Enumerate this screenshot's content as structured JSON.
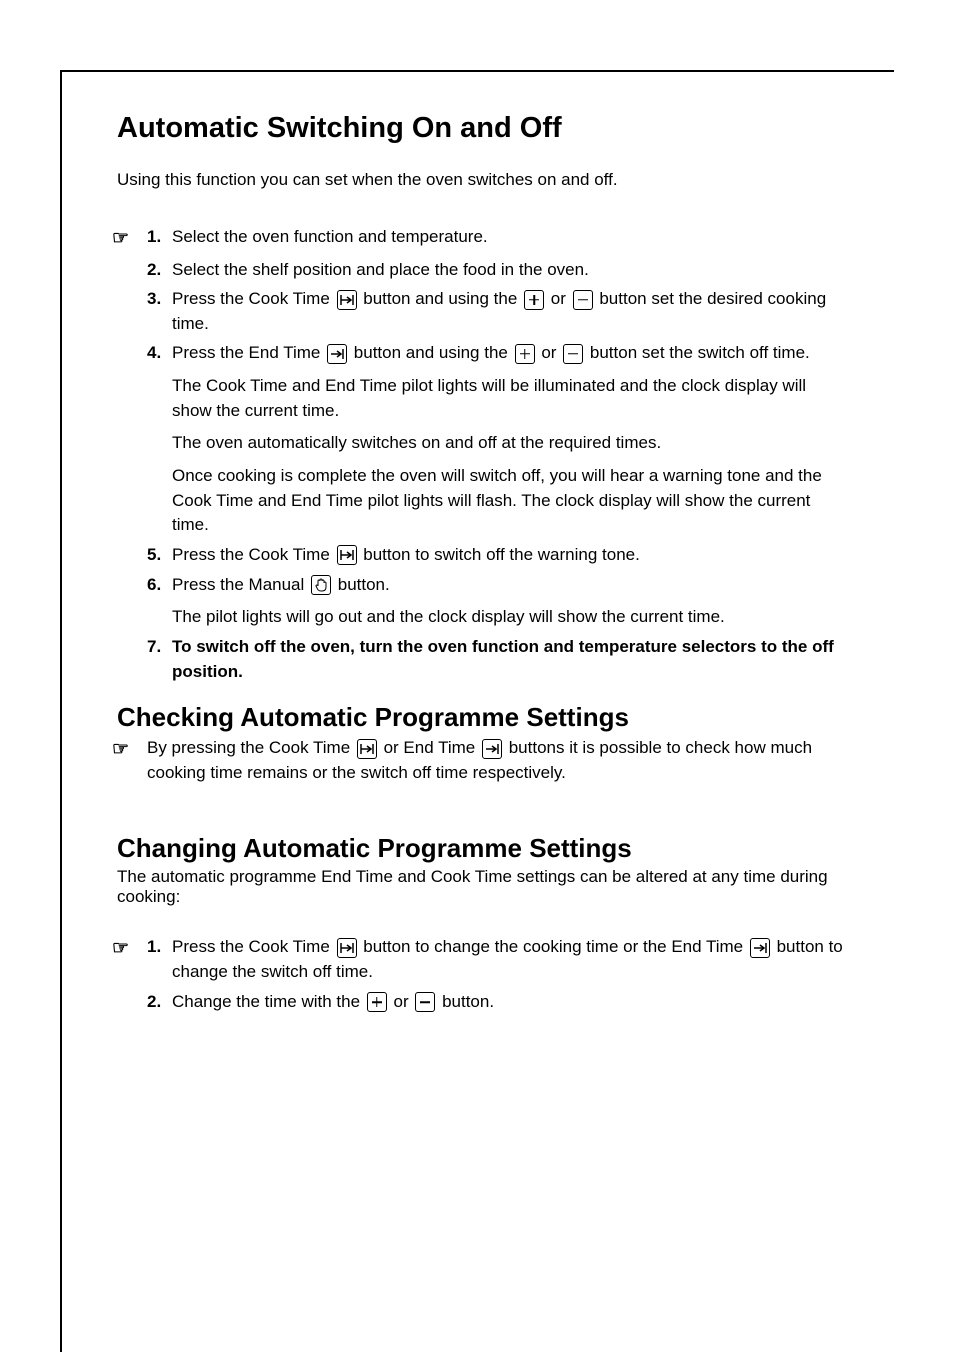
{
  "title": "Automatic Switching On and Off",
  "subtitle": "Using this function you can set when the oven switches on and off.",
  "steps_main": [
    {
      "num": "1.",
      "icon": true,
      "segments": [
        {
          "t": "Select the oven function and temperature."
        }
      ]
    },
    {
      "num": "2.",
      "icon": false,
      "segments": [
        {
          "t": "Select the shelf position and place the food in the oven."
        }
      ]
    },
    {
      "num": "3.",
      "icon": false,
      "segments": [
        {
          "t": "Press the Cook Time "
        },
        {
          "sym": "arrow-bar-right"
        },
        {
          "t": " button and using the "
        },
        {
          "sym": "plus"
        },
        {
          "t": " or "
        },
        {
          "sym": "minus"
        },
        {
          "t": " button set the desired cooking time."
        }
      ]
    },
    {
      "num": "4.",
      "icon": false,
      "segments": [
        {
          "t": "Press the End Time "
        },
        {
          "sym": "arrow-right"
        },
        {
          "t": " button and using the "
        },
        {
          "sym": "plus"
        },
        {
          "t": " or "
        },
        {
          "sym": "minus"
        },
        {
          "t": " button set the switch off time."
        }
      ],
      "extra": [
        "The Cook Time and End Time pilot lights will be illuminated and the clock display will show the current time.",
        "The oven automatically switches on and off at the required times.",
        "Once cooking is complete the oven will switch off, you will hear a warning tone and the Cook Time and End Time pilot lights will flash. The clock display will show the current time."
      ]
    },
    {
      "num": "5.",
      "icon": false,
      "segments": [
        {
          "t": "Press the Cook Time "
        },
        {
          "sym": "arrow-bar-right"
        },
        {
          "t": " button to switch off the warning tone."
        }
      ]
    },
    {
      "num": "6.",
      "icon": false,
      "segments": [
        {
          "t": "Press the Manual "
        },
        {
          "sym": "hand"
        },
        {
          "t": " button."
        }
      ],
      "extra": [
        "The pilot lights will go out and the clock display will show the current time."
      ]
    },
    {
      "num": "7.",
      "icon": false,
      "bold": true,
      "segments": [
        {
          "t": "To switch off the oven, turn the oven function and temperature selectors to the off position."
        }
      ]
    }
  ],
  "heading_check": "Checking Automatic Programme Settings",
  "check_step": {
    "icon": true,
    "segments": [
      {
        "t": "By pressing the Cook Time "
      },
      {
        "sym": "arrow-bar-right"
      },
      {
        "t": " or End Time "
      },
      {
        "sym": "arrow-right"
      },
      {
        "t": " buttons it is possible to check how much cooking time remains or the switch off time respectively."
      }
    ]
  },
  "heading_change": "Changing Automatic Programme Settings",
  "change_subtitle": "The automatic programme End Time and Cook Time settings can be altered at any time during cooking:",
  "change_steps": [
    {
      "num": "1.",
      "icon": true,
      "segments": [
        {
          "t": "Press the Cook Time "
        },
        {
          "sym": "arrow-bar-right"
        },
        {
          "t": " button to change the cooking time or the End Time "
        },
        {
          "sym": "arrow-right"
        },
        {
          "t": " button to change the switch off time."
        }
      ]
    },
    {
      "num": "2.",
      "icon": false,
      "segments": [
        {
          "t": "Change the time with the "
        },
        {
          "sym": "plus"
        },
        {
          "t": " or "
        },
        {
          "sym": "minus"
        },
        {
          "t": " button."
        }
      ]
    }
  ]
}
